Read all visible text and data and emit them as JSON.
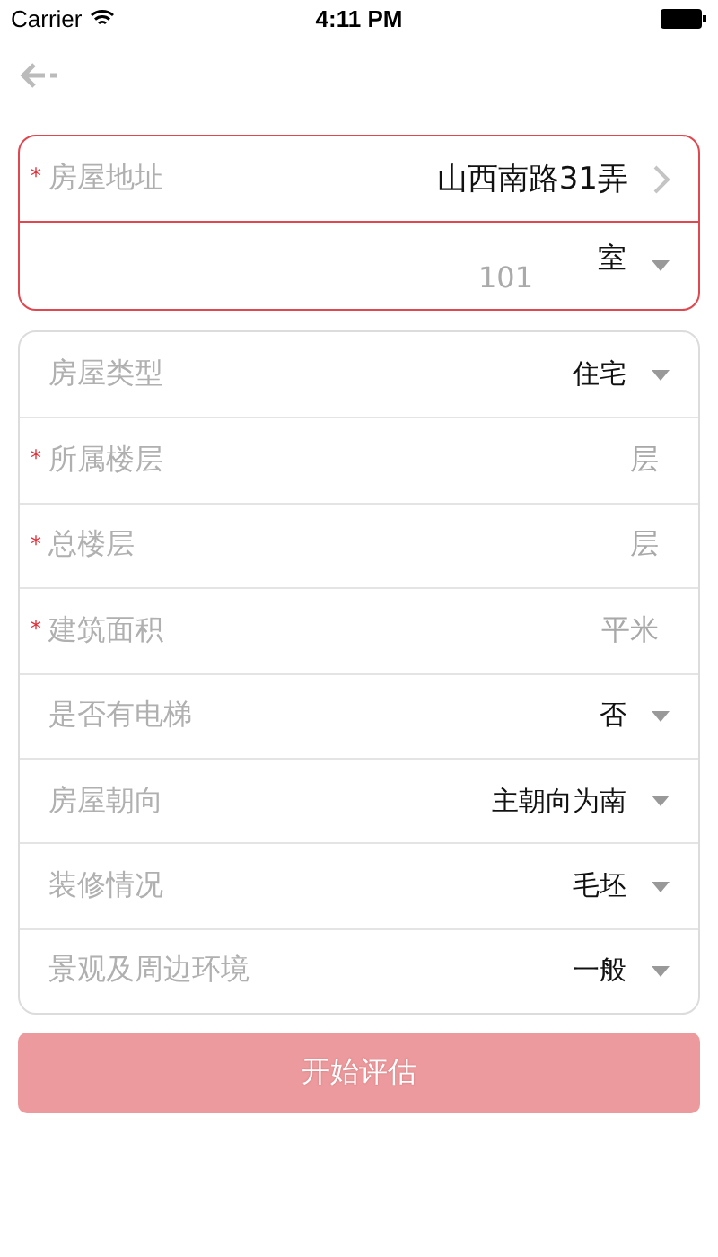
{
  "status_bar": {
    "carrier": "Carrier",
    "time": "4:11 PM"
  },
  "address_card": {
    "invalid": true,
    "rows": [
      {
        "kind": "link",
        "marker": "*",
        "label": "房屋地址",
        "value": "山西南路31弄"
      },
      {
        "kind": "room",
        "placeholder": "101",
        "value": "室"
      }
    ]
  },
  "details": [
    {
      "kind": "select",
      "label": "房屋类型",
      "value": "住宅"
    },
    {
      "kind": "input",
      "marker": "*",
      "label": "所属楼层",
      "unit": "层"
    },
    {
      "kind": "input",
      "marker": "*",
      "label": "总楼层",
      "unit": "层"
    },
    {
      "kind": "input",
      "marker": "*",
      "label": "建筑面积",
      "unit": "平米"
    },
    {
      "kind": "select",
      "label": "是否有电梯",
      "value": "否"
    },
    {
      "kind": "select",
      "label": "房屋朝向",
      "value": "主朝向为南"
    },
    {
      "kind": "select",
      "label": "装修情况",
      "value": "毛坯"
    },
    {
      "kind": "select",
      "label": "景观及周边环境",
      "value": "一般"
    }
  ],
  "submit": {
    "label": "开始评估",
    "disabled": true
  }
}
